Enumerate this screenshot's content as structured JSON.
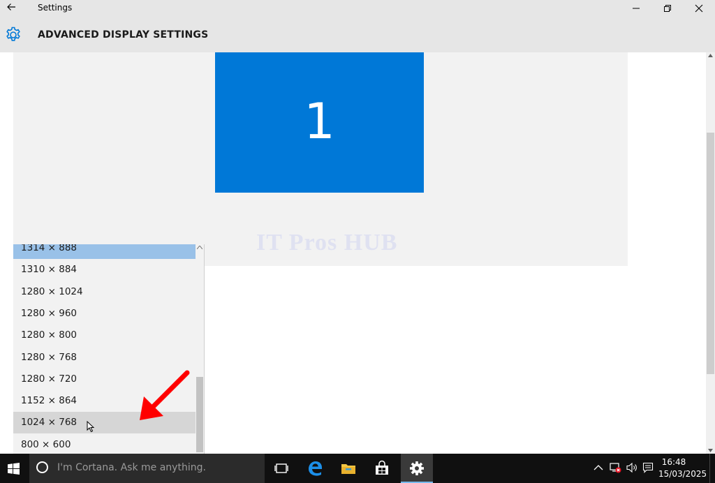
{
  "window": {
    "title": "Settings"
  },
  "page": {
    "title": "ADVANCED DISPLAY SETTINGS"
  },
  "preview": {
    "monitor_label": "1",
    "monitor_color": "#0078d7",
    "watermark": "IT Pros HUB"
  },
  "resolution_dropdown": {
    "items": [
      {
        "label": "1314 × 888",
        "state": "selected"
      },
      {
        "label": "1310 × 884",
        "state": "normal"
      },
      {
        "label": "1280 × 1024",
        "state": "normal"
      },
      {
        "label": "1280 × 960",
        "state": "normal"
      },
      {
        "label": "1280 × 800",
        "state": "normal"
      },
      {
        "label": "1280 × 768",
        "state": "normal"
      },
      {
        "label": "1280 × 720",
        "state": "normal"
      },
      {
        "label": "1152 × 864",
        "state": "normal"
      },
      {
        "label": "1024 × 768",
        "state": "hover"
      },
      {
        "label": "800 × 600",
        "state": "normal"
      }
    ],
    "selected_color": "#99c1e8"
  },
  "taskbar": {
    "search_placeholder": "I'm Cortana. Ask me anything.",
    "apps": [
      "task-view-icon",
      "edge-icon",
      "file-explorer-icon",
      "store-icon",
      "settings-icon"
    ],
    "active_app": "settings-icon",
    "time": "16:48",
    "date": "15/03/2025"
  },
  "colors": {
    "accent": "#0078d7",
    "annotation_arrow": "#ff0000"
  }
}
